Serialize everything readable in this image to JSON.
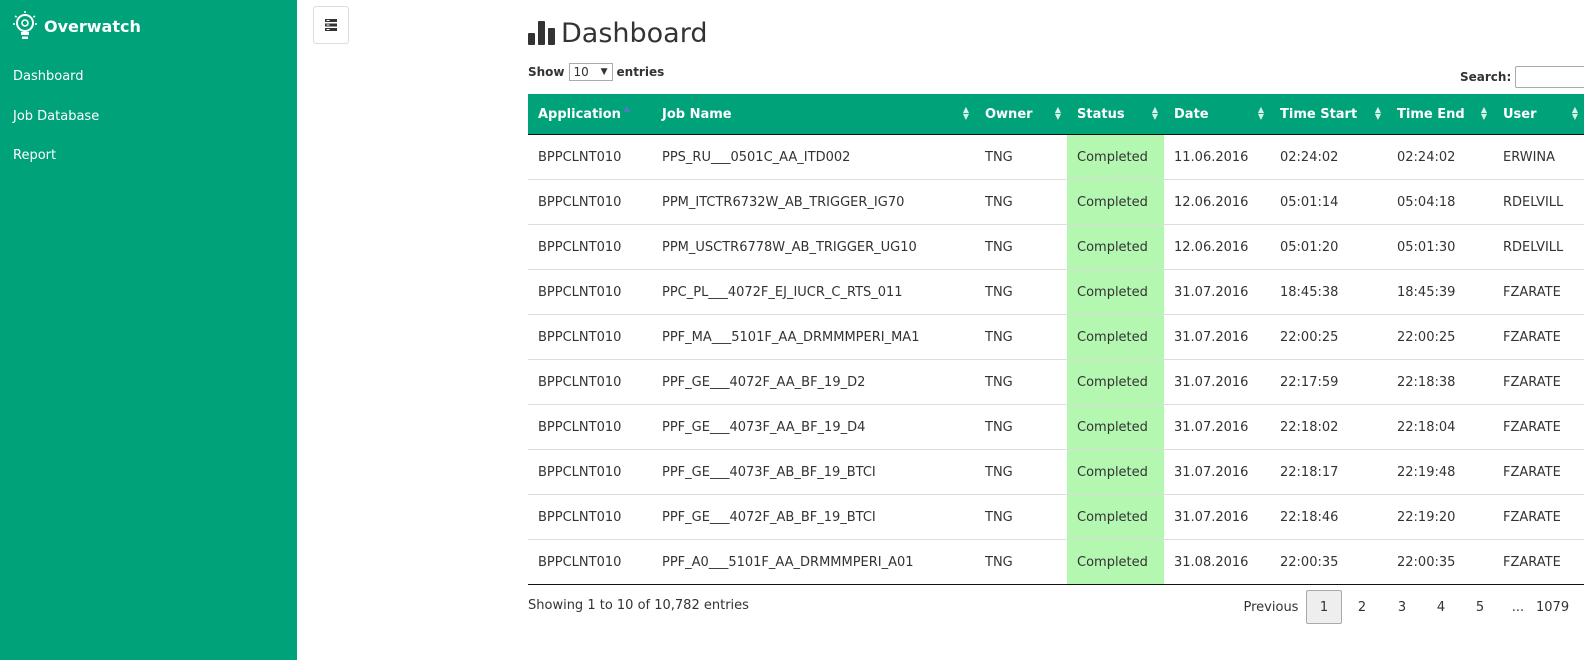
{
  "brand": {
    "name": "Overwatch"
  },
  "nav": {
    "items": [
      {
        "label": "Dashboard"
      },
      {
        "label": "Job Database"
      },
      {
        "label": "Report"
      }
    ]
  },
  "header": {
    "title": "Dashboard",
    "title_icon": "bar-chart-icon"
  },
  "toolbar": {
    "toggle_icon": "menu-toggle-icon"
  },
  "length": {
    "show_label": "Show",
    "value": "10",
    "entries_label": "entries"
  },
  "search": {
    "label": "Search:",
    "value": ""
  },
  "table": {
    "columns": [
      "Application",
      "Job Name",
      "Owner",
      "Status",
      "Date",
      "Time Start",
      "Time End",
      "User"
    ],
    "rows": [
      [
        "BPPCLNT010",
        "PPS_RU___0501C_AA_ITD002",
        "TNG",
        "Completed",
        "11.06.2016",
        "02:24:02",
        "02:24:02",
        "ERWINA"
      ],
      [
        "BPPCLNT010",
        "PPM_ITCTR6732W_AB_TRIGGER_IG70",
        "TNG",
        "Completed",
        "12.06.2016",
        "05:01:14",
        "05:04:18",
        "RDELVILL"
      ],
      [
        "BPPCLNT010",
        "PPM_USCTR6778W_AB_TRIGGER_UG10",
        "TNG",
        "Completed",
        "12.06.2016",
        "05:01:20",
        "05:01:30",
        "RDELVILL"
      ],
      [
        "BPPCLNT010",
        "PPC_PL___4072F_EJ_IUCR_C_RTS_011",
        "TNG",
        "Completed",
        "31.07.2016",
        "18:45:38",
        "18:45:39",
        "FZARATE"
      ],
      [
        "BPPCLNT010",
        "PPF_MA___5101F_AA_DRMMMPERI_MA1",
        "TNG",
        "Completed",
        "31.07.2016",
        "22:00:25",
        "22:00:25",
        "FZARATE"
      ],
      [
        "BPPCLNT010",
        "PPF_GE___4072F_AA_BF_19_D2",
        "TNG",
        "Completed",
        "31.07.2016",
        "22:17:59",
        "22:18:38",
        "FZARATE"
      ],
      [
        "BPPCLNT010",
        "PPF_GE___4073F_AA_BF_19_D4",
        "TNG",
        "Completed",
        "31.07.2016",
        "22:18:02",
        "22:18:04",
        "FZARATE"
      ],
      [
        "BPPCLNT010",
        "PPF_GE___4073F_AB_BF_19_BTCI",
        "TNG",
        "Completed",
        "31.07.2016",
        "22:18:17",
        "22:19:48",
        "FZARATE"
      ],
      [
        "BPPCLNT010",
        "PPF_GE___4072F_AB_BF_19_BTCI",
        "TNG",
        "Completed",
        "31.07.2016",
        "22:18:46",
        "22:19:20",
        "FZARATE"
      ],
      [
        "BPPCLNT010",
        "PPF_A0___5101F_AA_DRMMMPERI_A01",
        "TNG",
        "Completed",
        "31.08.2016",
        "22:00:35",
        "22:00:35",
        "FZARATE"
      ]
    ]
  },
  "footer": {
    "info": "Showing 1 to 10 of 10,782 entries",
    "previous": "Previous",
    "pages": [
      "1",
      "2",
      "3",
      "4",
      "5",
      "...",
      "1079"
    ]
  },
  "colors": {
    "brand": "#00a27a",
    "status_completed": "#b3f7b0"
  }
}
